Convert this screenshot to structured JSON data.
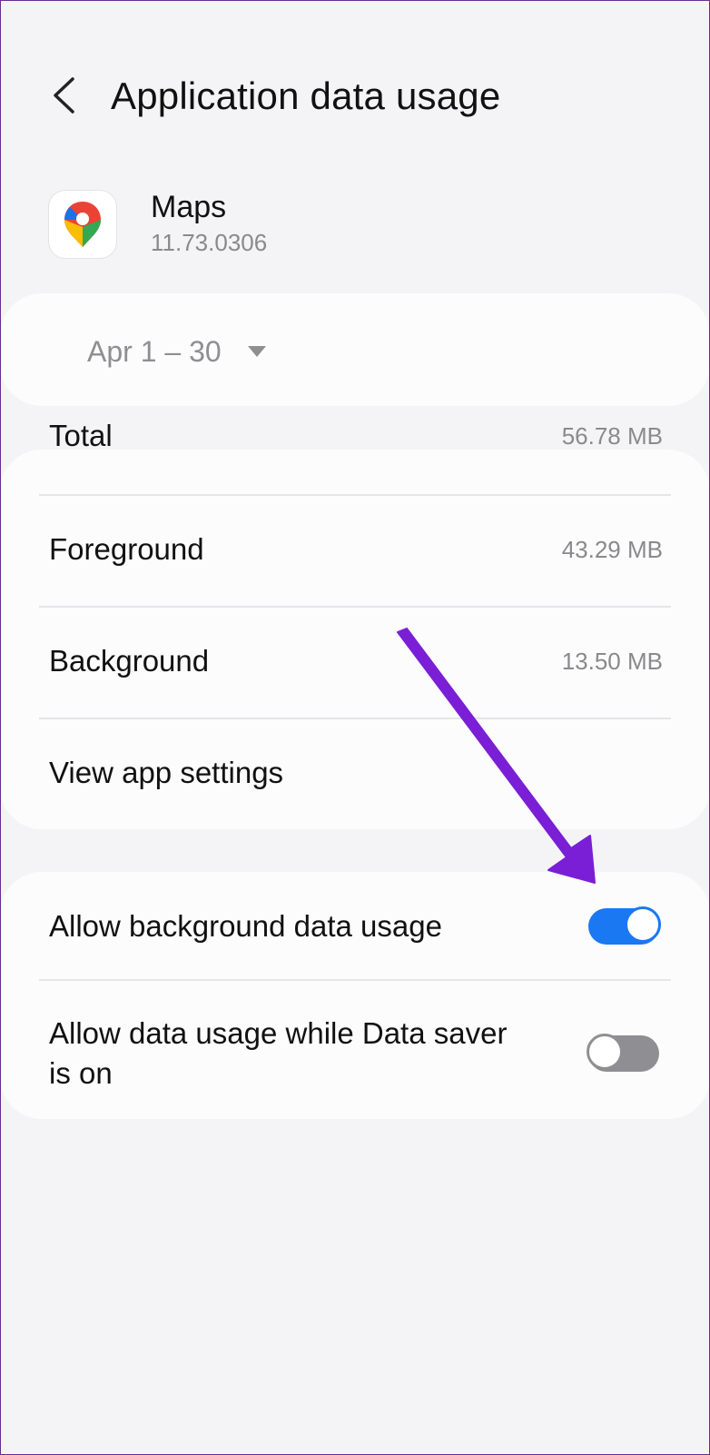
{
  "header": {
    "title": "Application data usage",
    "back_icon": "chevron-left-icon"
  },
  "app": {
    "name": "Maps",
    "version": "11.73.0306",
    "icon": "google-maps-pin-icon"
  },
  "period": {
    "label": "Apr 1 – 30",
    "dropdown_icon": "triangle-down-icon"
  },
  "usage": {
    "total_label": "Total",
    "total_value": "56.78 MB",
    "rows": [
      {
        "label": "Foreground",
        "value": "43.29 MB"
      },
      {
        "label": "Background",
        "value": "13.50 MB"
      }
    ],
    "view_settings_label": "View app settings"
  },
  "toggles": [
    {
      "label": "Allow background data usage",
      "on": true
    },
    {
      "label": "Allow data usage while Data saver is on",
      "on": false
    }
  ],
  "colors": {
    "switch_on": "#1a78f2",
    "switch_off": "#8f8f93",
    "annotation_arrow": "#7a1fd6",
    "background": "#f4f4f6",
    "card": "#fcfcfd"
  },
  "annotation": {
    "icon": "arrow-annotation"
  }
}
